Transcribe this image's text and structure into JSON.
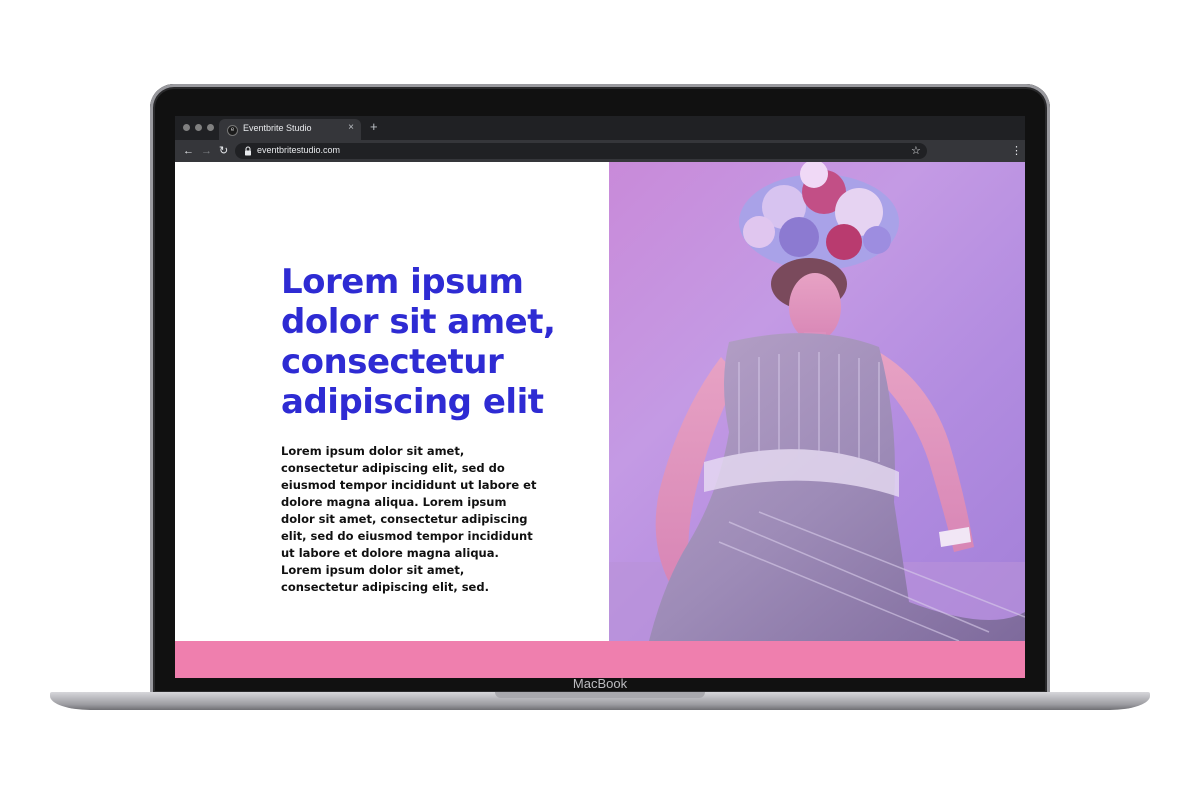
{
  "device": {
    "brand_label": "MacBook"
  },
  "browser": {
    "tab": {
      "title": "Eventbrite Studio",
      "close_glyph": "×",
      "favicon": "e"
    },
    "new_tab_glyph": "+",
    "url": "eventbritestudio.com",
    "icons": {
      "back": "arrow-left-icon",
      "forward": "arrow-right-icon",
      "reload": "reload-icon",
      "lock": "lock-icon",
      "bookmark": "star-icon",
      "menu": "kebab-menu-icon"
    }
  },
  "page": {
    "heading": "Lorem ipsum dolor sit amet, consectetur adipiscing elit",
    "body": "Lorem ipsum dolor sit amet, consectetur adipiscing elit, sed do eiusmod tempor incididunt ut labore et dolore magna aliqua. Lorem ipsum dolor sit amet, consectetur adipiscing elit, sed do eiusmod tempor incididunt ut labore et dolore magna aliqua. Lorem ipsum dolor sit amet, consectetur adipiscing elit, sed."
  },
  "colors": {
    "heading": "#2e2bd3",
    "footer_band": "#ef7fae",
    "photo_background": "#c49ae4",
    "browser_frame": "#202124"
  }
}
